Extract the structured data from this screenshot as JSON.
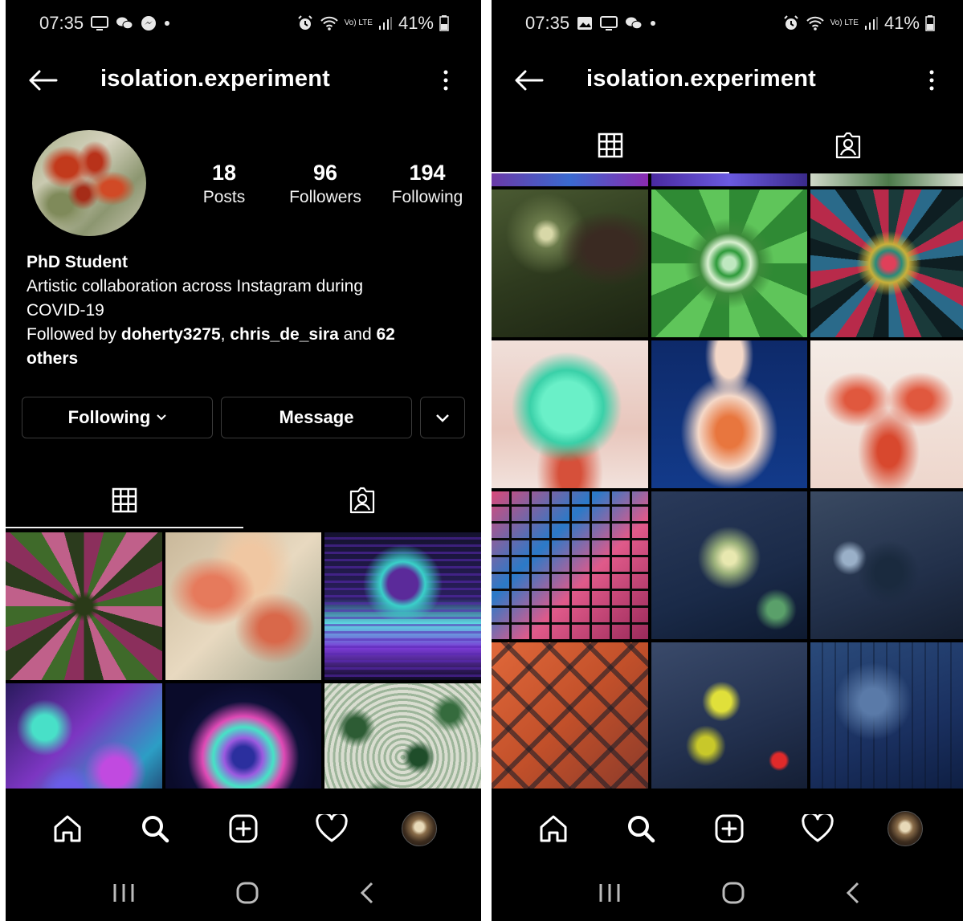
{
  "status_bar": {
    "left_time": "07:35",
    "right_time": "07:35",
    "battery": "41%",
    "network": "Vo) LTE"
  },
  "header": {
    "username": "isolation.experiment"
  },
  "profile": {
    "posts_count": "18",
    "posts_label": "Posts",
    "followers_count": "96",
    "followers_label": "Followers",
    "following_count": "194",
    "following_label": "Following",
    "bio_name": "PhD Student",
    "bio_line1": "Artistic collaboration across Instagram during",
    "bio_line2": "COVID-19",
    "followed_by_prefix": "Followed by",
    "followed_user1": "doherty3275",
    "followed_sep": ",",
    "followed_user2": "chris_de_sira",
    "followed_and": "and",
    "followed_count": "62",
    "followed_others": "others"
  },
  "actions": {
    "following_label": "Following",
    "message_label": "Message"
  },
  "left_grid_tiles": [
    "kaleidoscope-magenta",
    "watercolor-coral",
    "neon-reflection",
    "swirl-purple-cyan",
    "neon-mandala",
    "green-lichen"
  ],
  "right_grid_tiles": [
    "forest-figure",
    "green-mandala",
    "dark-fractal",
    "mint-burst",
    "silhouette-veins",
    "coral-veins",
    "pink-squares",
    "blue-splatter",
    "blue-forest",
    "orange-plaid",
    "yellow-snake",
    "deep-blue-texture"
  ],
  "colors": {
    "background": "#000000",
    "text": "#ffffff",
    "button_border": "#3a3a3a"
  }
}
